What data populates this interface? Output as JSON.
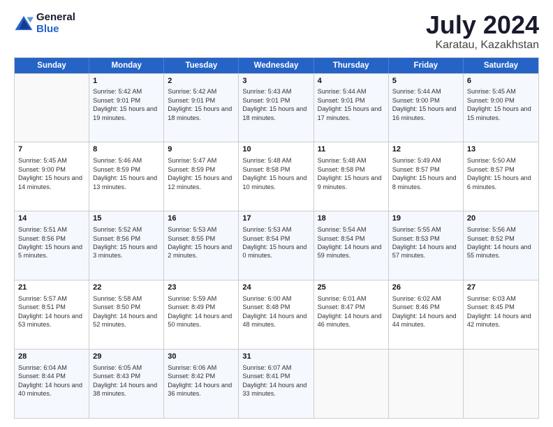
{
  "logo": {
    "line1": "General",
    "line2": "Blue"
  },
  "title": "July 2024",
  "subtitle": "Karatau, Kazakhstan",
  "days_of_week": [
    "Sunday",
    "Monday",
    "Tuesday",
    "Wednesday",
    "Thursday",
    "Friday",
    "Saturday"
  ],
  "weeks": [
    [
      {
        "day": "",
        "sunrise": "",
        "sunset": "",
        "daylight": ""
      },
      {
        "day": "1",
        "sunrise": "Sunrise: 5:42 AM",
        "sunset": "Sunset: 9:01 PM",
        "daylight": "Daylight: 15 hours and 19 minutes."
      },
      {
        "day": "2",
        "sunrise": "Sunrise: 5:42 AM",
        "sunset": "Sunset: 9:01 PM",
        "daylight": "Daylight: 15 hours and 18 minutes."
      },
      {
        "day": "3",
        "sunrise": "Sunrise: 5:43 AM",
        "sunset": "Sunset: 9:01 PM",
        "daylight": "Daylight: 15 hours and 18 minutes."
      },
      {
        "day": "4",
        "sunrise": "Sunrise: 5:44 AM",
        "sunset": "Sunset: 9:01 PM",
        "daylight": "Daylight: 15 hours and 17 minutes."
      },
      {
        "day": "5",
        "sunrise": "Sunrise: 5:44 AM",
        "sunset": "Sunset: 9:00 PM",
        "daylight": "Daylight: 15 hours and 16 minutes."
      },
      {
        "day": "6",
        "sunrise": "Sunrise: 5:45 AM",
        "sunset": "Sunset: 9:00 PM",
        "daylight": "Daylight: 15 hours and 15 minutes."
      }
    ],
    [
      {
        "day": "7",
        "sunrise": "Sunrise: 5:45 AM",
        "sunset": "Sunset: 9:00 PM",
        "daylight": "Daylight: 15 hours and 14 minutes."
      },
      {
        "day": "8",
        "sunrise": "Sunrise: 5:46 AM",
        "sunset": "Sunset: 8:59 PM",
        "daylight": "Daylight: 15 hours and 13 minutes."
      },
      {
        "day": "9",
        "sunrise": "Sunrise: 5:47 AM",
        "sunset": "Sunset: 8:59 PM",
        "daylight": "Daylight: 15 hours and 12 minutes."
      },
      {
        "day": "10",
        "sunrise": "Sunrise: 5:48 AM",
        "sunset": "Sunset: 8:58 PM",
        "daylight": "Daylight: 15 hours and 10 minutes."
      },
      {
        "day": "11",
        "sunrise": "Sunrise: 5:48 AM",
        "sunset": "Sunset: 8:58 PM",
        "daylight": "Daylight: 15 hours and 9 minutes."
      },
      {
        "day": "12",
        "sunrise": "Sunrise: 5:49 AM",
        "sunset": "Sunset: 8:57 PM",
        "daylight": "Daylight: 15 hours and 8 minutes."
      },
      {
        "day": "13",
        "sunrise": "Sunrise: 5:50 AM",
        "sunset": "Sunset: 8:57 PM",
        "daylight": "Daylight: 15 hours and 6 minutes."
      }
    ],
    [
      {
        "day": "14",
        "sunrise": "Sunrise: 5:51 AM",
        "sunset": "Sunset: 8:56 PM",
        "daylight": "Daylight: 15 hours and 5 minutes."
      },
      {
        "day": "15",
        "sunrise": "Sunrise: 5:52 AM",
        "sunset": "Sunset: 8:56 PM",
        "daylight": "Daylight: 15 hours and 3 minutes."
      },
      {
        "day": "16",
        "sunrise": "Sunrise: 5:53 AM",
        "sunset": "Sunset: 8:55 PM",
        "daylight": "Daylight: 15 hours and 2 minutes."
      },
      {
        "day": "17",
        "sunrise": "Sunrise: 5:53 AM",
        "sunset": "Sunset: 8:54 PM",
        "daylight": "Daylight: 15 hours and 0 minutes."
      },
      {
        "day": "18",
        "sunrise": "Sunrise: 5:54 AM",
        "sunset": "Sunset: 8:54 PM",
        "daylight": "Daylight: 14 hours and 59 minutes."
      },
      {
        "day": "19",
        "sunrise": "Sunrise: 5:55 AM",
        "sunset": "Sunset: 8:53 PM",
        "daylight": "Daylight: 14 hours and 57 minutes."
      },
      {
        "day": "20",
        "sunrise": "Sunrise: 5:56 AM",
        "sunset": "Sunset: 8:52 PM",
        "daylight": "Daylight: 14 hours and 55 minutes."
      }
    ],
    [
      {
        "day": "21",
        "sunrise": "Sunrise: 5:57 AM",
        "sunset": "Sunset: 8:51 PM",
        "daylight": "Daylight: 14 hours and 53 minutes."
      },
      {
        "day": "22",
        "sunrise": "Sunrise: 5:58 AM",
        "sunset": "Sunset: 8:50 PM",
        "daylight": "Daylight: 14 hours and 52 minutes."
      },
      {
        "day": "23",
        "sunrise": "Sunrise: 5:59 AM",
        "sunset": "Sunset: 8:49 PM",
        "daylight": "Daylight: 14 hours and 50 minutes."
      },
      {
        "day": "24",
        "sunrise": "Sunrise: 6:00 AM",
        "sunset": "Sunset: 8:48 PM",
        "daylight": "Daylight: 14 hours and 48 minutes."
      },
      {
        "day": "25",
        "sunrise": "Sunrise: 6:01 AM",
        "sunset": "Sunset: 8:47 PM",
        "daylight": "Daylight: 14 hours and 46 minutes."
      },
      {
        "day": "26",
        "sunrise": "Sunrise: 6:02 AM",
        "sunset": "Sunset: 8:46 PM",
        "daylight": "Daylight: 14 hours and 44 minutes."
      },
      {
        "day": "27",
        "sunrise": "Sunrise: 6:03 AM",
        "sunset": "Sunset: 8:45 PM",
        "daylight": "Daylight: 14 hours and 42 minutes."
      }
    ],
    [
      {
        "day": "28",
        "sunrise": "Sunrise: 6:04 AM",
        "sunset": "Sunset: 8:44 PM",
        "daylight": "Daylight: 14 hours and 40 minutes."
      },
      {
        "day": "29",
        "sunrise": "Sunrise: 6:05 AM",
        "sunset": "Sunset: 8:43 PM",
        "daylight": "Daylight: 14 hours and 38 minutes."
      },
      {
        "day": "30",
        "sunrise": "Sunrise: 6:06 AM",
        "sunset": "Sunset: 8:42 PM",
        "daylight": "Daylight: 14 hours and 36 minutes."
      },
      {
        "day": "31",
        "sunrise": "Sunrise: 6:07 AM",
        "sunset": "Sunset: 8:41 PM",
        "daylight": "Daylight: 14 hours and 33 minutes."
      },
      {
        "day": "",
        "sunrise": "",
        "sunset": "",
        "daylight": ""
      },
      {
        "day": "",
        "sunrise": "",
        "sunset": "",
        "daylight": ""
      },
      {
        "day": "",
        "sunrise": "",
        "sunset": "",
        "daylight": ""
      }
    ]
  ]
}
